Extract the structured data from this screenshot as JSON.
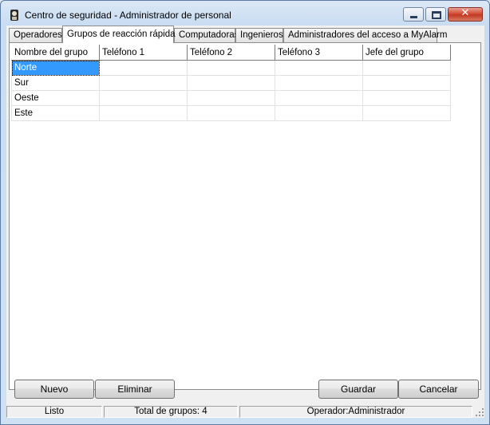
{
  "window": {
    "title": "Centro de seguridad - Administrador de personal",
    "icon": "shield-user-icon",
    "controls": [
      "minimize",
      "maximize",
      "close"
    ]
  },
  "tabs": [
    {
      "label": "Operadores",
      "active": false
    },
    {
      "label": "Grupos de reacción rápida",
      "active": true
    },
    {
      "label": "Computadoras",
      "active": false
    },
    {
      "label": "Ingenieros",
      "active": false
    },
    {
      "label": "Administradores del acceso a MyAlarm",
      "active": false
    }
  ],
  "grid": {
    "columns": [
      "Nombre del grupo",
      "Teléfono 1",
      "Teléfono 2",
      "Teléfono 3",
      "Jefe del grupo"
    ],
    "rows": [
      [
        "Norte",
        "",
        "",
        "",
        ""
      ],
      [
        "Sur",
        "",
        "",
        "",
        ""
      ],
      [
        "Oeste",
        "",
        "",
        "",
        ""
      ],
      [
        "Este",
        "",
        "",
        "",
        ""
      ]
    ],
    "selected_row": 0
  },
  "buttons": {
    "new": "Nuevo",
    "delete": "Eliminar",
    "save": "Guardar",
    "cancel": "Cancelar"
  },
  "status": {
    "state": "Listo",
    "total": "Total de grupos: 4",
    "operator": "Operador:Administrador"
  },
  "colors": {
    "selection": "#3399ff",
    "close_button": "#c9412a"
  }
}
